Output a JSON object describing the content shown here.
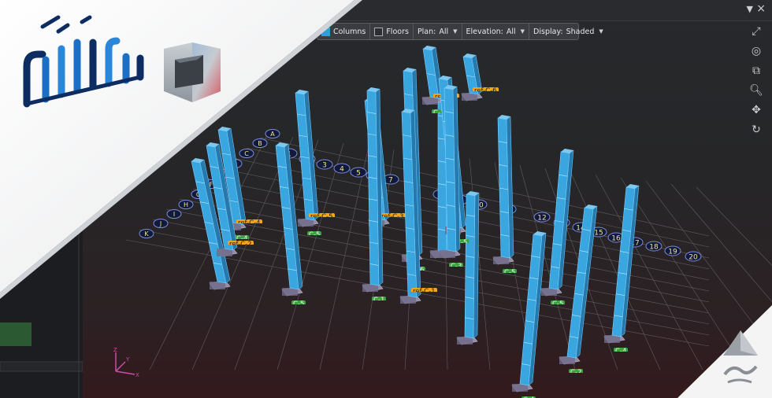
{
  "filter_bar": {
    "columns_label": "Columns",
    "floors_label": "Floors",
    "plan_label": "Plan:",
    "plan_value": "All",
    "elevation_label": "Elevation:",
    "elevation_value": "All",
    "display_label": "Display:",
    "display_value": "Shaded"
  },
  "grid_letters": [
    "A",
    "B",
    "C",
    "D",
    "E",
    "F",
    "G",
    "H",
    "I",
    "J",
    "K"
  ],
  "grid_numbers": [
    "1",
    "2",
    "3",
    "4",
    "5",
    "6",
    "7",
    "8",
    "9",
    "10",
    "11",
    "12",
    "13",
    "14",
    "15",
    "16",
    "17",
    "18",
    "19",
    "20"
  ],
  "columns": [
    {
      "ref": "ref-C-4",
      "label": "C-4"
    },
    {
      "ref": "ref-C-5",
      "label": "C-5"
    },
    {
      "ref": "ref-C-2",
      "label": ""
    },
    {
      "ref": "",
      "label": "C-5"
    },
    {
      "ref": "ref-C-3",
      "label": ""
    },
    {
      "ref": "",
      "label": "C-1"
    },
    {
      "ref": "ref-C-7",
      "label": "C-7"
    },
    {
      "ref": "",
      "label": "C-6"
    },
    {
      "ref": "ref-C-1",
      "label": ""
    },
    {
      "ref": "",
      "label": "C-5"
    },
    {
      "ref": "ref-C-6",
      "label": ""
    },
    {
      "ref": "",
      "label": "C-3"
    },
    {
      "ref": "",
      "label": "C-5"
    },
    {
      "ref": "",
      "label": "C-5"
    },
    {
      "ref": "",
      "label": "C-4"
    },
    {
      "ref": "",
      "label": "C-2"
    },
    {
      "ref": "",
      "label": "C-4"
    }
  ],
  "axis_labels": {
    "z": "Z",
    "y": "Y",
    "x": "X"
  },
  "colors": {
    "column_fill": "#3aa6e0",
    "ref_tag": "#f2a516",
    "col_tag": "#3aa33a",
    "footing": "#8f8aa6",
    "grid_line": "#8a8d92"
  }
}
